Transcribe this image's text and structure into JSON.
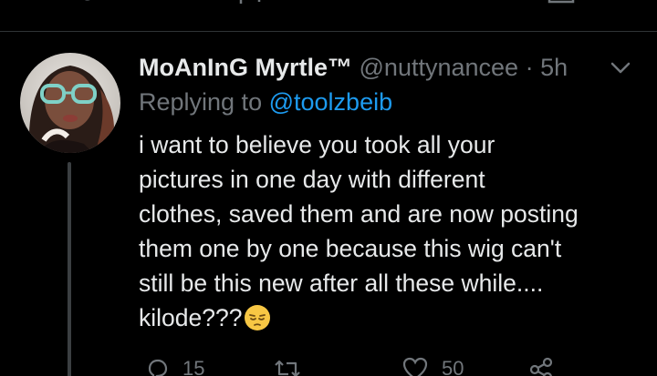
{
  "tweet": {
    "display_name": "MoAnInG Myrtle™",
    "handle": "@nuttynancee",
    "separator": "·",
    "time": "5h",
    "replying_prefix": "Replying to",
    "replying_to": "@toolzbeib",
    "text_lines": [
      "i want to believe you took all your",
      "pictures in one day with different",
      "clothes, saved them and are now posting",
      "them one by one because this wig can't",
      "still be this new after all these while....",
      "kilode???"
    ],
    "emoji": "pensive-face-emoji",
    "actions": {
      "reply_count": "15",
      "like_count": "50"
    }
  },
  "colors": {
    "background": "#000000",
    "text": "#e7e9ea",
    "secondary": "#71767b",
    "link": "#1d9bf0",
    "divider": "#2f3336"
  },
  "icons": [
    "reply-icon",
    "retweet-icon",
    "like-icon",
    "share-icon",
    "chevron-down-icon"
  ]
}
